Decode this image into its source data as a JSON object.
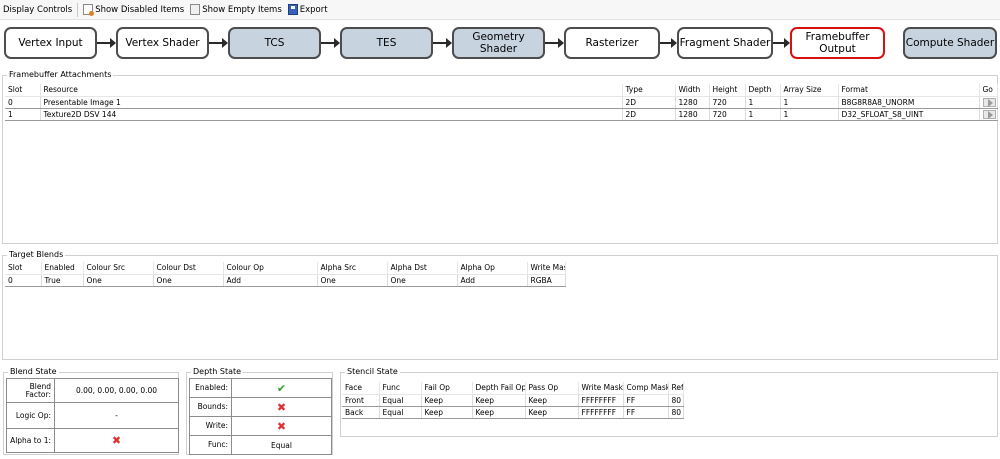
{
  "toolbar": {
    "display_controls": "Display Controls",
    "show_disabled": "Show Disabled Items",
    "show_empty": "Show Empty Items",
    "export": "Export"
  },
  "pipeline": {
    "stages": [
      {
        "label": "Vertex Input",
        "state": "normal"
      },
      {
        "label": "Vertex Shader",
        "state": "normal"
      },
      {
        "label": "TCS",
        "state": "disabled"
      },
      {
        "label": "TES",
        "state": "disabled"
      },
      {
        "label": "Geometry Shader",
        "state": "disabled"
      },
      {
        "label": "Rasterizer",
        "state": "normal"
      },
      {
        "label": "Fragment Shader",
        "state": "normal"
      },
      {
        "label": "Framebuffer\nOutput",
        "state": "active"
      },
      {
        "label": "Compute Shader",
        "state": "disabled"
      }
    ]
  },
  "framebuffer": {
    "title": "Framebuffer Attachments",
    "headers": {
      "slot": "Slot",
      "resource": "Resource",
      "type": "Type",
      "width": "Width",
      "height": "Height",
      "depth": "Depth",
      "array_size": "Array Size",
      "format": "Format",
      "go": "Go"
    },
    "rows": [
      {
        "slot": "0",
        "resource": "Presentable Image 1",
        "type": "2D",
        "width": "1280",
        "height": "720",
        "depth": "1",
        "array_size": "1",
        "format": "B8G8R8A8_UNORM"
      },
      {
        "slot": "1",
        "resource": "Texture2D DSV 144",
        "type": "2D",
        "width": "1280",
        "height": "720",
        "depth": "1",
        "array_size": "1",
        "format": "D32_SFLOAT_S8_UINT"
      }
    ]
  },
  "blends": {
    "title": "Target Blends",
    "headers": {
      "slot": "Slot",
      "enabled": "Enabled",
      "colour_src": "Colour Src",
      "colour_dst": "Colour Dst",
      "colour_op": "Colour Op",
      "alpha_src": "Alpha Src",
      "alpha_dst": "Alpha Dst",
      "alpha_op": "Alpha Op",
      "write_mask": "Write Mask"
    },
    "rows": [
      {
        "slot": "0",
        "enabled": "True",
        "colour_src": "One",
        "colour_dst": "One",
        "colour_op": "Add",
        "alpha_src": "One",
        "alpha_dst": "One",
        "alpha_op": "Add",
        "write_mask": "RGBA"
      }
    ]
  },
  "blend_state": {
    "title": "Blend State",
    "blend_factor_label": "Blend Factor:",
    "blend_factor_value": "0.00, 0.00, 0.00, 0.00",
    "logic_op_label": "Logic Op:",
    "logic_op_value": "-",
    "alpha_to_1_label": "Alpha to 1:"
  },
  "depth_state": {
    "title": "Depth State",
    "enabled_label": "Enabled:",
    "bounds_label": "Bounds:",
    "write_label": "Write:",
    "func_label": "Func:",
    "func_value": "Equal"
  },
  "stencil": {
    "title": "Stencil State",
    "headers": {
      "face": "Face",
      "func": "Func",
      "fail_op": "Fail Op",
      "depth_fail_op": "Depth Fail Op",
      "pass_op": "Pass Op",
      "write_mask": "Write Mask",
      "comp_mask": "Comp Mask",
      "ref": "Ref"
    },
    "rows": [
      {
        "face": "Front",
        "func": "Equal",
        "fail_op": "Keep",
        "depth_fail_op": "Keep",
        "pass_op": "Keep",
        "write_mask": "FFFFFFFF",
        "comp_mask": "FF",
        "ref": "80"
      },
      {
        "face": "Back",
        "func": "Equal",
        "fail_op": "Keep",
        "depth_fail_op": "Keep",
        "pass_op": "Keep",
        "write_mask": "FFFFFFFF",
        "comp_mask": "FF",
        "ref": "80"
      }
    ]
  },
  "icons": {
    "check": "✔",
    "cross": "✖"
  },
  "colors": {
    "disabled_stage": "#c7d3df",
    "active_stage_border": "#d71010",
    "check": "#2aa02a",
    "cross": "#e03030"
  }
}
